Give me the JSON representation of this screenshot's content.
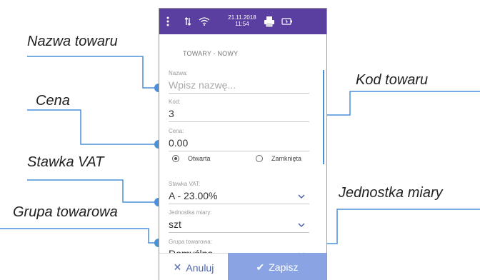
{
  "statusbar": {
    "menu_icon": "vertical-dots-icon",
    "signal_icon": "data-transfer-icon",
    "wifi_icon": "wifi-icon",
    "date": "21.11.2018",
    "time": "11:54",
    "printer_icon": "printer-icon",
    "battery_icon": "battery-icon"
  },
  "page_title": "TOWARY - NOWY",
  "form": {
    "name": {
      "label": "Nazwa:",
      "placeholder": "Wpisz nazwę..."
    },
    "code": {
      "label": "Kod:",
      "value": "3"
    },
    "price": {
      "label": "Cena:",
      "value": "0.00"
    },
    "price_type": {
      "option_open": "Otwarta",
      "option_closed": "Zamknięta",
      "selected": "Otwarta"
    },
    "vat": {
      "label": "Stawka VAT:",
      "value": "A - 23.00%"
    },
    "unit": {
      "label": "Jednostka miary:",
      "value": "szt"
    },
    "group": {
      "label": "Grupa towarowa:",
      "value": "Domyślna"
    }
  },
  "buttons": {
    "cancel": "Anuluj",
    "save": "Zapisz"
  },
  "annotations": {
    "name": "Nazwa towaru",
    "price": "Cena",
    "vat": "Stawka VAT",
    "group": "Grupa towarowa",
    "code": "Kod towaru",
    "unit": "Jednostka miary"
  },
  "colors": {
    "statusbar": "#5b3fa0",
    "accent": "#4a90d9",
    "save_button": "#8aa3e3"
  }
}
